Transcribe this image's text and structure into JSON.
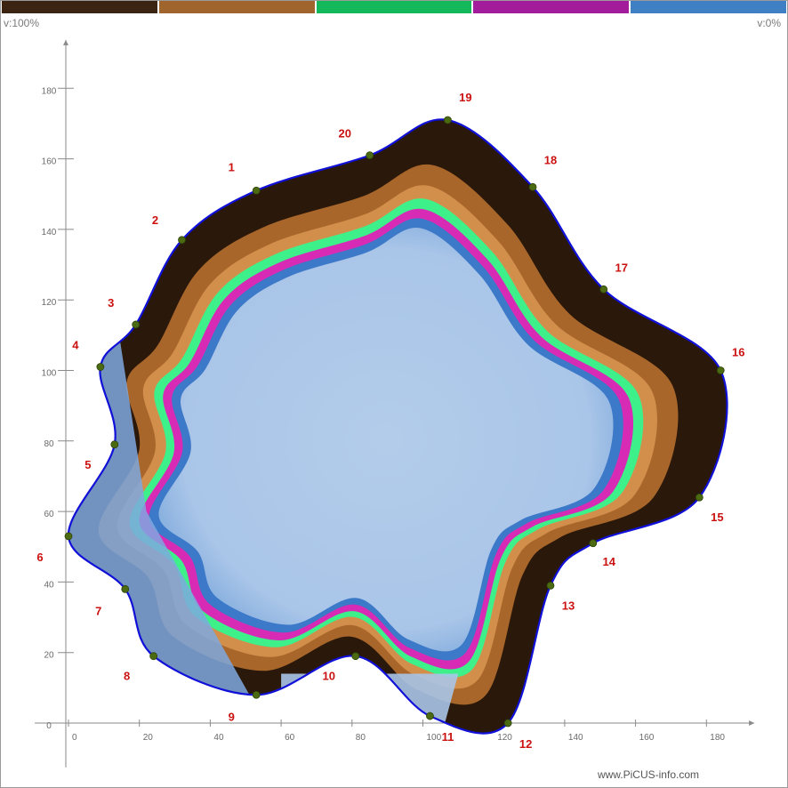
{
  "legend": {
    "max_label": "v:100%",
    "min_label": "v:0%",
    "colors": [
      {
        "name": "dark-brown",
        "hex": "#3b2412"
      },
      {
        "name": "brown",
        "hex": "#a0652c"
      },
      {
        "name": "green",
        "hex": "#12b85a"
      },
      {
        "name": "magenta",
        "hex": "#a31c9c"
      },
      {
        "name": "blue",
        "hex": "#3f7fc4"
      }
    ]
  },
  "watermark": "www.PiCUS-info.com",
  "chart_data": {
    "type": "scatter",
    "xlim": [
      -5,
      190
    ],
    "ylim": [
      -5,
      195
    ],
    "x_ticks": [
      "0",
      "20",
      "40",
      "60",
      "80",
      "100",
      "120",
      "140",
      "160",
      "180"
    ],
    "x_tick_values": [
      0,
      20,
      40,
      60,
      80,
      100,
      120,
      140,
      160,
      180
    ],
    "y_ticks": [
      "0",
      "20",
      "40",
      "60",
      "80",
      "100",
      "120",
      "140",
      "160",
      "180"
    ],
    "y_tick_values": [
      0,
      20,
      40,
      60,
      80,
      100,
      120,
      140,
      160,
      180
    ],
    "grid": false,
    "measuring_points": [
      {
        "label": "1",
        "x": 53,
        "y": 151
      },
      {
        "label": "2",
        "x": 32,
        "y": 137
      },
      {
        "label": "3",
        "x": 19,
        "y": 113
      },
      {
        "label": "4",
        "x": 9,
        "y": 101
      },
      {
        "label": "5",
        "x": 13,
        "y": 79
      },
      {
        "label": "6",
        "x": 0,
        "y": 53
      },
      {
        "label": "7",
        "x": 16,
        "y": 38
      },
      {
        "label": "8",
        "x": 24,
        "y": 19
      },
      {
        "label": "9",
        "x": 53,
        "y": 8
      },
      {
        "label": "10",
        "x": 81,
        "y": 19
      },
      {
        "label": "11",
        "x": 102,
        "y": 2
      },
      {
        "label": "12",
        "x": 124,
        "y": 0
      },
      {
        "label": "13",
        "x": 136,
        "y": 39
      },
      {
        "label": "14",
        "x": 148,
        "y": 51
      },
      {
        "label": "15",
        "x": 178,
        "y": 64
      },
      {
        "label": "16",
        "x": 184,
        "y": 100
      },
      {
        "label": "17",
        "x": 151,
        "y": 123
      },
      {
        "label": "18",
        "x": 131,
        "y": 152
      },
      {
        "label": "19",
        "x": 107,
        "y": 171
      },
      {
        "label": "20",
        "x": 85,
        "y": 161
      }
    ],
    "tomogram_zones": [
      "dark-brown",
      "brown",
      "green",
      "magenta",
      "blue"
    ]
  }
}
